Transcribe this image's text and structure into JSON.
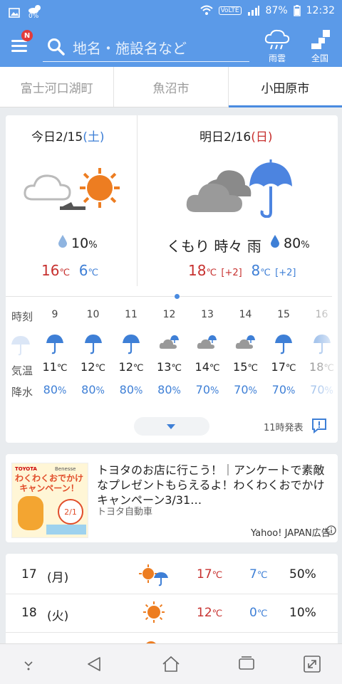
{
  "status_bar": {
    "battery": "87%",
    "time": "12:32",
    "data_badge": "0%",
    "volte": "VoLTE"
  },
  "header": {
    "notification_badge": "N",
    "search_placeholder": "地名・施設名など",
    "rain_cloud_label": "雨雲",
    "nationwide_label": "全国"
  },
  "tabs": [
    {
      "label": "富士河口湖町",
      "active": false
    },
    {
      "label": "魚沼市",
      "active": false
    },
    {
      "label": "小田原市",
      "active": true
    }
  ],
  "today": {
    "label_prefix": "今日2/15",
    "weekday": "(土)",
    "precip": "10",
    "precip_unit": "%",
    "high": "16",
    "low": "6",
    "temp_unit": "℃"
  },
  "tomorrow": {
    "label_prefix": "明日2/16",
    "weekday": "(日)",
    "condition": "くもり 時々 雨",
    "precip": "80",
    "precip_unit": "%",
    "high": "18",
    "high_diff": "[+2]",
    "low": "8",
    "low_diff": "[+2]",
    "temp_unit": "℃"
  },
  "hourly": {
    "time_label": "時刻",
    "temp_label": "気温",
    "rain_label": "降水",
    "temp_unit": "℃",
    "precip_unit": "%",
    "hours": [
      {
        "hour": "9",
        "icon": "umbrella-icon",
        "temp": "11",
        "precip": "80"
      },
      {
        "hour": "10",
        "icon": "umbrella-icon",
        "temp": "12",
        "precip": "80"
      },
      {
        "hour": "11",
        "icon": "umbrella-icon",
        "temp": "12",
        "precip": "80"
      },
      {
        "hour": "12",
        "icon": "cloud-umbrella-icon",
        "temp": "13",
        "precip": "80"
      },
      {
        "hour": "13",
        "icon": "cloud-umbrella-icon",
        "temp": "14",
        "precip": "70"
      },
      {
        "hour": "14",
        "icon": "cloud-umbrella-icon",
        "temp": "15",
        "precip": "70"
      },
      {
        "hour": "15",
        "icon": "umbrella-icon",
        "temp": "17",
        "precip": "70"
      },
      {
        "hour": "16",
        "icon": "umbrella-icon",
        "temp": "18",
        "precip": "70"
      }
    ],
    "release_time": "11時発表"
  },
  "ad": {
    "brand": "TOYOTA",
    "partner": "Benesse",
    "banner_title": "わくわくおでかけ キャンペーン！",
    "banner_date": "2/1",
    "text": "トヨタのお店に行こう！｜アンケートで素敵なプレゼントもらえるよ！わくわくおでかけキャンペーン3/31…",
    "sponsor": "トヨタ自動車",
    "ad_label": "Yahoo! JAPAN広告"
  },
  "weekly": [
    {
      "day": "17",
      "weekday": "(月)",
      "icon": "sun-umbrella-icon",
      "high": "17",
      "low": "7",
      "precip": "50%",
      "temp_unit": "℃"
    },
    {
      "day": "18",
      "weekday": "(火)",
      "icon": "sun-icon",
      "high": "12",
      "low": "0",
      "precip": "10%",
      "temp_unit": "℃"
    }
  ],
  "colors": {
    "header": "#5b9ae8",
    "sun": "#ed7d21",
    "umbrella": "#3e7fd6",
    "high": "#c7312f",
    "low": "#3e7fd6"
  }
}
